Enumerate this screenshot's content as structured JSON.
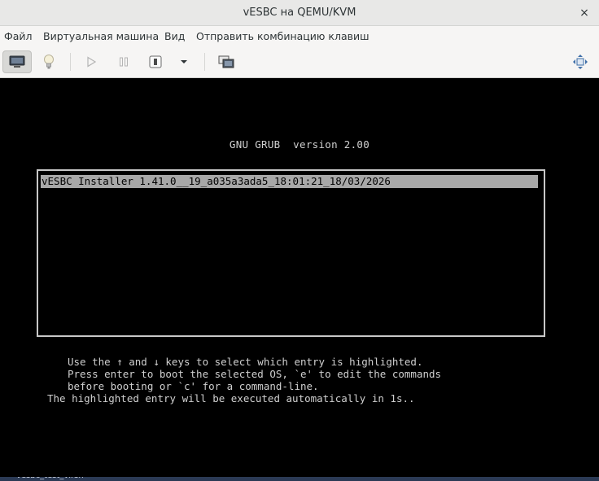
{
  "window": {
    "title": "vESBC на QEMU/KVM",
    "close_glyph": "×"
  },
  "menu": {
    "items": [
      "Файл",
      "Виртуальная машина",
      "Вид",
      "Отправить комбинацию клавиш"
    ]
  },
  "toolbar": {
    "buttons": [
      {
        "name": "console-icon",
        "active": true
      },
      {
        "name": "lightbulb-icon",
        "active": false
      },
      {
        "name": "play-icon",
        "active": false
      },
      {
        "name": "pause-icon",
        "active": false
      },
      {
        "name": "shutdown-icon",
        "active": false
      },
      {
        "name": "chevron-down-icon",
        "active": false
      },
      {
        "name": "screenshot-icon",
        "active": false
      },
      {
        "name": "resize-arrows-icon",
        "active": false
      }
    ]
  },
  "grub": {
    "header": "GNU GRUB  version 2.00",
    "selected_entry": "vESBC Installer 1.41.0__19_a035a3ada5_18:01:21_18/03/2026",
    "help_lines": [
      "Use the ↑ and ↓ keys to select which entry is highlighted.",
      "Press enter to boot the selected OS, `e' to edit the commands",
      "before booting or `c' for a command-line."
    ],
    "countdown_line": "The highlighted entry will be executed automatically in 1s.."
  },
  "taskbar": {
    "partial_label": "vesbc_test_virsh"
  },
  "colors": {
    "titlebar_bg": "#e8e8e7",
    "menubar_bg": "#f6f5f4",
    "guest_bg": "#000000",
    "grub_text": "#c6c6c6",
    "grub_highlight": "#a8a8a8"
  }
}
